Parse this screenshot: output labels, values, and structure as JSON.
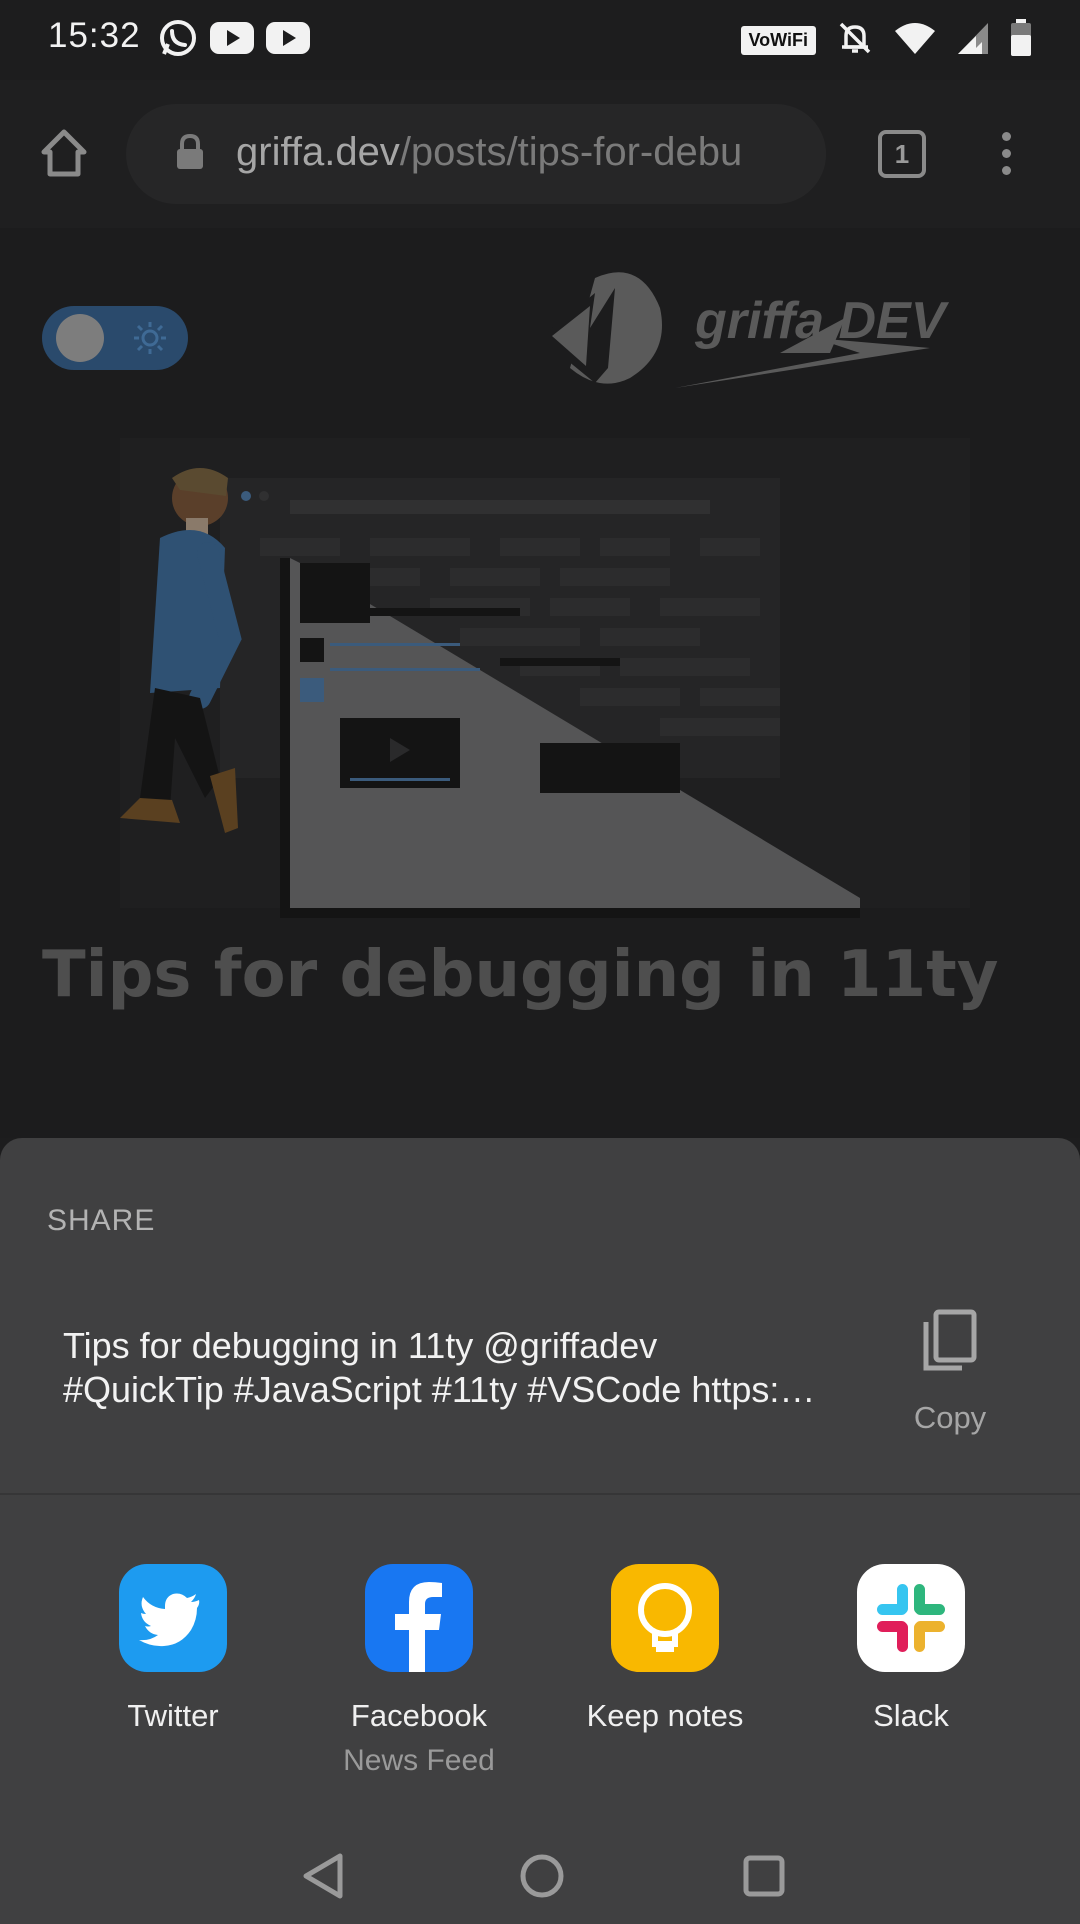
{
  "status_bar": {
    "time": "15:32",
    "left_icons": [
      "whatsapp-icon",
      "youtube-icon",
      "youtube-icon"
    ],
    "vowifi": "VoWiFi",
    "right_icons": [
      "bell-off-icon",
      "wifi-icon",
      "signal-icon",
      "battery-icon"
    ]
  },
  "browser": {
    "url_host": "griffa.dev",
    "url_path": "/posts/tips-for-debu",
    "tab_count": "1"
  },
  "page": {
    "logo_text": "griffa.DEV",
    "title": "Tips for debugging in 11ty"
  },
  "share_sheet": {
    "heading": "SHARE",
    "text_line1": "Tips for debugging in 11ty @griffadev",
    "text_line2": "#QuickTip #JavaScript #11ty #VSCode https:…",
    "copy_label": "Copy",
    "apps": [
      {
        "label": "Twitter",
        "sub": "",
        "color": "#1d9bf0"
      },
      {
        "label": "Facebook",
        "sub": "News Feed",
        "color": "#1877f2"
      },
      {
        "label": "Keep notes",
        "sub": "",
        "color": "#f9b800"
      },
      {
        "label": "Slack",
        "sub": "",
        "color": "#ffffff"
      }
    ]
  },
  "nav_bar": {
    "buttons": [
      "back-icon",
      "home-icon",
      "recents-icon"
    ]
  },
  "colors": {
    "sheet_bg": "#404041",
    "page_dim": "#1c1c1d",
    "toggle_accent": "#2a4a6c"
  }
}
